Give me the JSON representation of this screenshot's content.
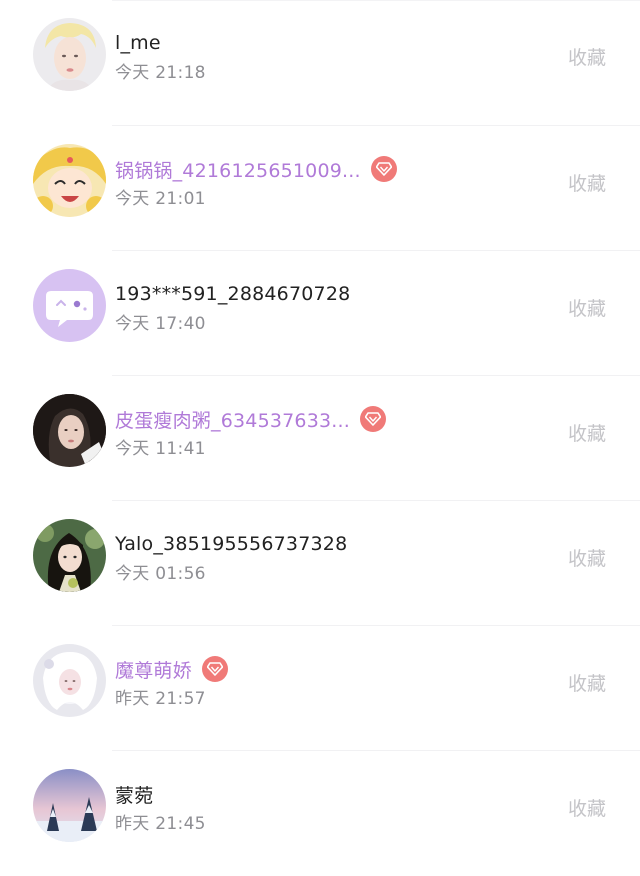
{
  "conversations": [
    {
      "name": "l_me",
      "time": "今天 21:18",
      "vip": false,
      "action": "收藏",
      "avatar": "avatar-photo-blond-person"
    },
    {
      "name": "锅锅锅_4216125651009...",
      "time": "今天 21:01",
      "vip": true,
      "action": "收藏",
      "avatar": "avatar-anime-girl"
    },
    {
      "name": "193***591_2884670728",
      "time": "今天 17:40",
      "vip": false,
      "action": "收藏",
      "avatar": "avatar-default-chat-bubble"
    },
    {
      "name": "皮蛋瘦肉粥_634537633...",
      "time": "今天 11:41",
      "vip": true,
      "action": "收藏",
      "avatar": "avatar-photo-dark-hair-girl"
    },
    {
      "name": "Yalo_385195556737328",
      "time": "今天 01:56",
      "vip": false,
      "action": "收藏",
      "avatar": "avatar-photo-girl-green"
    },
    {
      "name": "魔尊萌娇",
      "time": "昨天 21:57",
      "vip": true,
      "action": "收藏",
      "avatar": "avatar-photo-white-hair"
    },
    {
      "name": "蒙菀",
      "time": "昨天 21:45",
      "vip": false,
      "action": "收藏",
      "avatar": "avatar-winter-landscape"
    }
  ],
  "colors": {
    "vip_name": "#b07ad8",
    "vip_badge": "#f07a78",
    "normal_name": "#222222",
    "time_text": "#8e8e93",
    "action_text": "#c4c4c8"
  }
}
